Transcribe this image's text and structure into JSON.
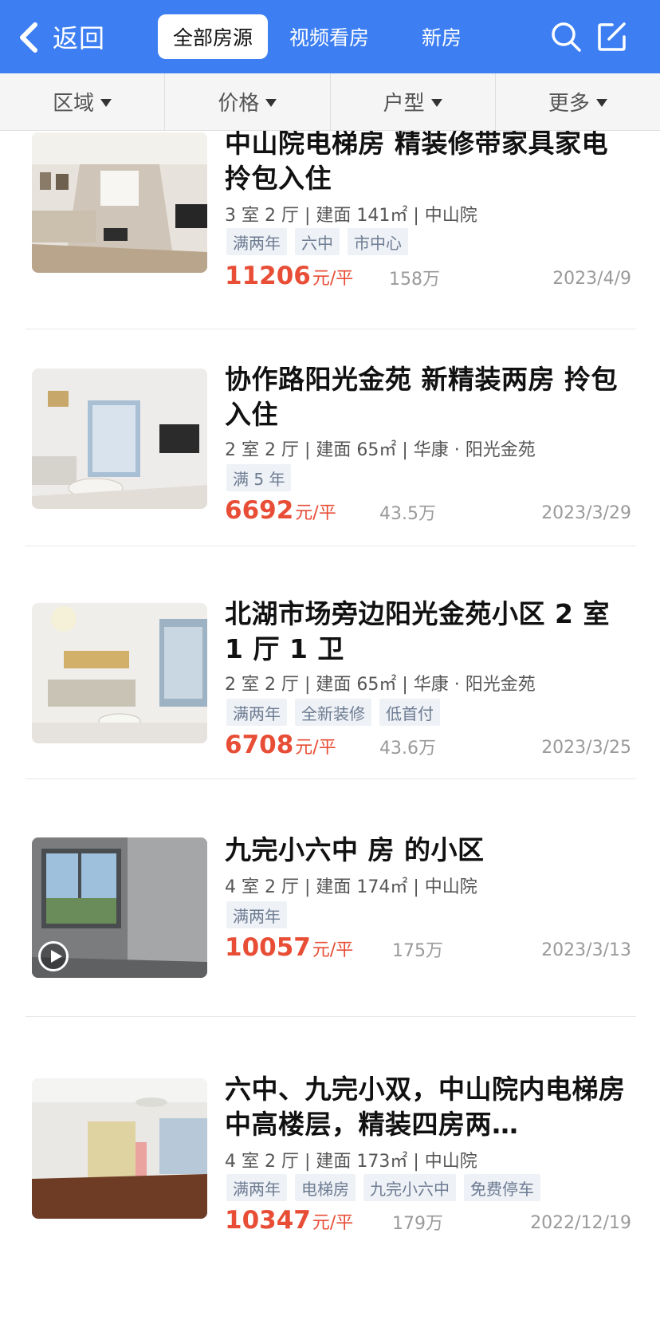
{
  "header": {
    "back_label": "返回",
    "tabs": [
      {
        "label": "全部房源",
        "active": true
      },
      {
        "label": "视频看房",
        "active": false
      },
      {
        "label": "新房",
        "active": false
      }
    ],
    "icons": [
      "search-icon",
      "edit-icon"
    ],
    "bg_color": "#3d7ff2"
  },
  "filters": [
    {
      "label": "区域"
    },
    {
      "label": "价格"
    },
    {
      "label": "户型"
    },
    {
      "label": "更多"
    }
  ],
  "listings": [
    {
      "title": "中山院电梯房 精装修带家具家电 拎包入住",
      "info": "3 室 2 厅 | 建面 141㎡ | 中山院",
      "tags": [
        "满两年",
        "六中",
        "市中心"
      ],
      "unit_price": "11206",
      "unit_suffix": "元/平",
      "total": "158万",
      "date": "2023/4/9",
      "has_video": false
    },
    {
      "title": "协作路阳光金苑 新精装两房 拎包入住",
      "info": "2 室 2 厅 | 建面 65㎡ | 华康 · 阳光金苑",
      "tags": [
        "满 5 年"
      ],
      "unit_price": "6692",
      "unit_suffix": "元/平",
      "total": "43.5万",
      "date": "2023/3/29",
      "has_video": false
    },
    {
      "title": "北湖市场旁边阳光金苑小区 2 室 1 厅 1 卫",
      "info": "2 室 2 厅 | 建面 65㎡ | 华康 · 阳光金苑",
      "tags": [
        "满两年",
        "全新装修",
        "低首付"
      ],
      "unit_price": "6708",
      "unit_suffix": "元/平",
      "total": "43.6万",
      "date": "2023/3/25",
      "has_video": false
    },
    {
      "title": "九完小六中 房 的小区",
      "info": "4 室 2 厅 | 建面 174㎡ | 中山院",
      "tags": [
        "满两年"
      ],
      "unit_price": "10057",
      "unit_suffix": "元/平",
      "total": "175万",
      "date": "2023/3/13",
      "has_video": true
    },
    {
      "title": "六中、九完小双，中山院内电梯房中高楼层，精装四房两…",
      "info": "4 室 2 厅 | 建面 173㎡ | 中山院",
      "tags": [
        "满两年",
        "电梯房",
        "九完小六中",
        "免费停车"
      ],
      "unit_price": "10347",
      "unit_suffix": "元/平",
      "total": "179万",
      "date": "2022/12/19",
      "has_video": false
    }
  ]
}
